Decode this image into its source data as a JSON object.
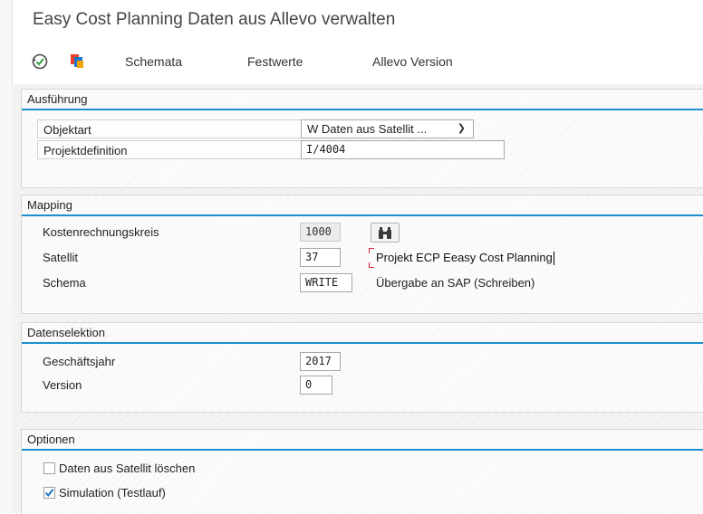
{
  "window": {
    "title": "Easy Cost Planning Daten aus Allevo verwalten"
  },
  "toolbar": {
    "execute_icon": "execute-clock-icon",
    "variant_icon": "copy-layers-icon",
    "schemata_label": "Schemata",
    "festwerte_label": "Festwerte",
    "allevo_version_label": "Allevo Version"
  },
  "ausfuehrung": {
    "title": "Ausführung",
    "objektart_label": "Objektart",
    "objektart_value": "W Daten aus Satellit ...",
    "projektdefinition_label": "Projektdefinition",
    "projektdefinition_value": "I/4004"
  },
  "mapping": {
    "title": "Mapping",
    "kostenrechnungskreis_label": "Kostenrechnungskreis",
    "kostenrechnungskreis_value": "1000",
    "satellit_label": "Satellit",
    "satellit_value": "37",
    "satellit_desc": "Projekt ECP Eeasy Cost Planning",
    "schema_label": "Schema",
    "schema_value": "WRITE",
    "schema_desc": "Übergabe an SAP (Schreiben)",
    "search_icon": "binoculars-icon"
  },
  "datenselektion": {
    "title": "Datenselektion",
    "geschaeftsjahr_label": "Geschäftsjahr",
    "geschaeftsjahr_value": "2017",
    "version_label": "Version",
    "version_value": "0"
  },
  "optionen": {
    "title": "Optionen",
    "delete_label": "Daten aus Satellit löschen",
    "delete_checked": false,
    "simulation_label": "Simulation (Testlauf)",
    "simulation_checked": true
  },
  "colors": {
    "accent": "#1d8fce",
    "check": "#1a73c9",
    "focus_bracket": "#dd2233"
  }
}
